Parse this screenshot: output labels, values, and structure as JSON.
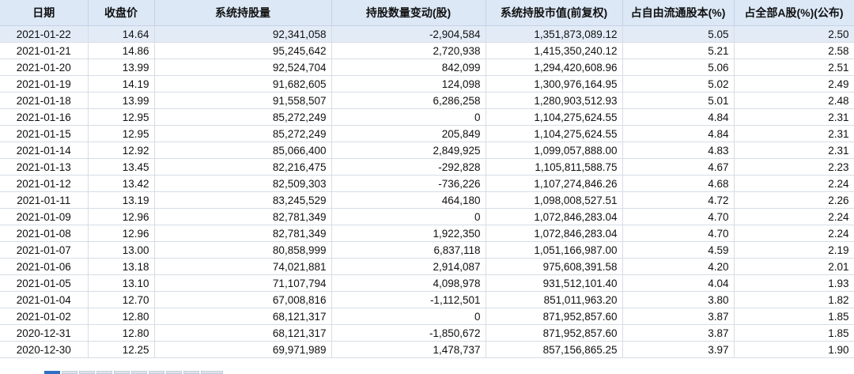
{
  "table": {
    "columns": [
      "日期",
      "收盘价",
      "系统持股量",
      "持股数量变动(股)",
      "系统持股市值(前复权)",
      "占自由流通股本(%)",
      "占全部A股(%)(公布)"
    ],
    "rows": [
      [
        "2021-01-22",
        "14.64",
        "92,341,058",
        "-2,904,584",
        "1,351,873,089.12",
        "5.05",
        "2.50"
      ],
      [
        "2021-01-21",
        "14.86",
        "95,245,642",
        "2,720,938",
        "1,415,350,240.12",
        "5.21",
        "2.58"
      ],
      [
        "2021-01-20",
        "13.99",
        "92,524,704",
        "842,099",
        "1,294,420,608.96",
        "5.06",
        "2.51"
      ],
      [
        "2021-01-19",
        "14.19",
        "91,682,605",
        "124,098",
        "1,300,976,164.95",
        "5.02",
        "2.49"
      ],
      [
        "2021-01-18",
        "13.99",
        "91,558,507",
        "6,286,258",
        "1,280,903,512.93",
        "5.01",
        "2.48"
      ],
      [
        "2021-01-16",
        "12.95",
        "85,272,249",
        "0",
        "1,104,275,624.55",
        "4.84",
        "2.31"
      ],
      [
        "2021-01-15",
        "12.95",
        "85,272,249",
        "205,849",
        "1,104,275,624.55",
        "4.84",
        "2.31"
      ],
      [
        "2021-01-14",
        "12.92",
        "85,066,400",
        "2,849,925",
        "1,099,057,888.00",
        "4.83",
        "2.31"
      ],
      [
        "2021-01-13",
        "13.45",
        "82,216,475",
        "-292,828",
        "1,105,811,588.75",
        "4.67",
        "2.23"
      ],
      [
        "2021-01-12",
        "13.42",
        "82,509,303",
        "-736,226",
        "1,107,274,846.26",
        "4.68",
        "2.24"
      ],
      [
        "2021-01-11",
        "13.19",
        "83,245,529",
        "464,180",
        "1,098,008,527.51",
        "4.72",
        "2.26"
      ],
      [
        "2021-01-09",
        "12.96",
        "82,781,349",
        "0",
        "1,072,846,283.04",
        "4.70",
        "2.24"
      ],
      [
        "2021-01-08",
        "12.96",
        "82,781,349",
        "1,922,350",
        "1,072,846,283.04",
        "4.70",
        "2.24"
      ],
      [
        "2021-01-07",
        "13.00",
        "80,858,999",
        "6,837,118",
        "1,051,166,987.00",
        "4.59",
        "2.19"
      ],
      [
        "2021-01-06",
        "13.18",
        "74,021,881",
        "2,914,087",
        "975,608,391.58",
        "4.20",
        "2.01"
      ],
      [
        "2021-01-05",
        "13.10",
        "71,107,794",
        "4,098,978",
        "931,512,101.40",
        "4.04",
        "1.93"
      ],
      [
        "2021-01-04",
        "12.70",
        "67,008,816",
        "-1,112,501",
        "851,011,963.20",
        "3.80",
        "1.82"
      ],
      [
        "2021-01-02",
        "12.80",
        "68,121,317",
        "0",
        "871,952,857.60",
        "3.87",
        "1.85"
      ],
      [
        "2020-12-31",
        "12.80",
        "68,121,317",
        "-1,850,672",
        "871,952,857.60",
        "3.87",
        "1.85"
      ],
      [
        "2020-12-30",
        "12.25",
        "69,971,989",
        "1,478,737",
        "857,156,865.25",
        "3.97",
        "1.90"
      ]
    ],
    "selected_row": 0
  },
  "colors": {
    "header_bg": "#dce8f6",
    "selected_row_bg": "#e3ebf7",
    "grid_line": "#d7dde6",
    "accent": "#2f6fc2"
  }
}
